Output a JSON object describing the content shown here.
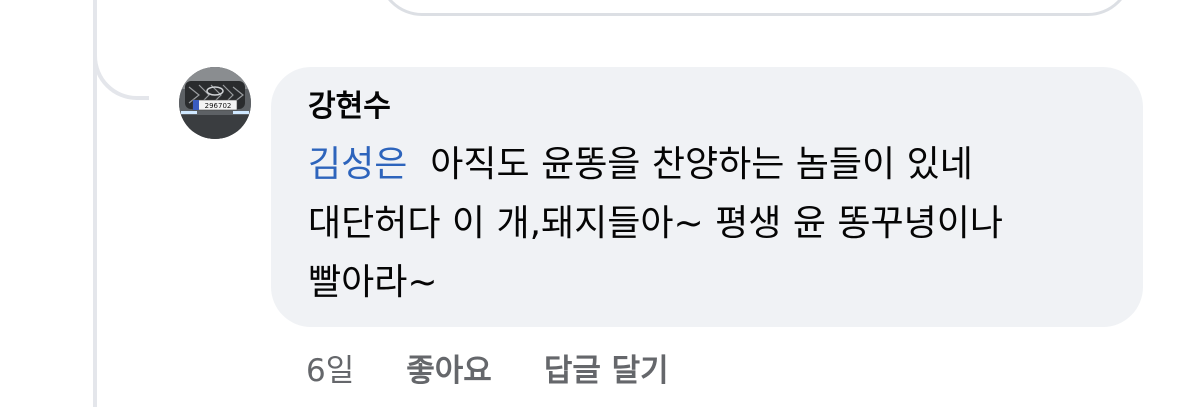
{
  "comment": {
    "author": "강현수",
    "mention": "김성은",
    "text_line1": "아직도 윤똥을 찬양하는 놈들이 있네",
    "text_line2": "대단허다 이 개,돼지들아~ 평생 윤 똥꾸녕이나",
    "text_line3": "빨아라~",
    "avatar_plate": "296702"
  },
  "actions": {
    "timestamp": "6일",
    "like_label": "좋아요",
    "reply_label": "답글 달기"
  },
  "colors": {
    "bubble_bg": "#f0f2f5",
    "mention": "#2d64bc",
    "secondary_text": "#65676b",
    "thread_line": "#e4e6eb"
  }
}
